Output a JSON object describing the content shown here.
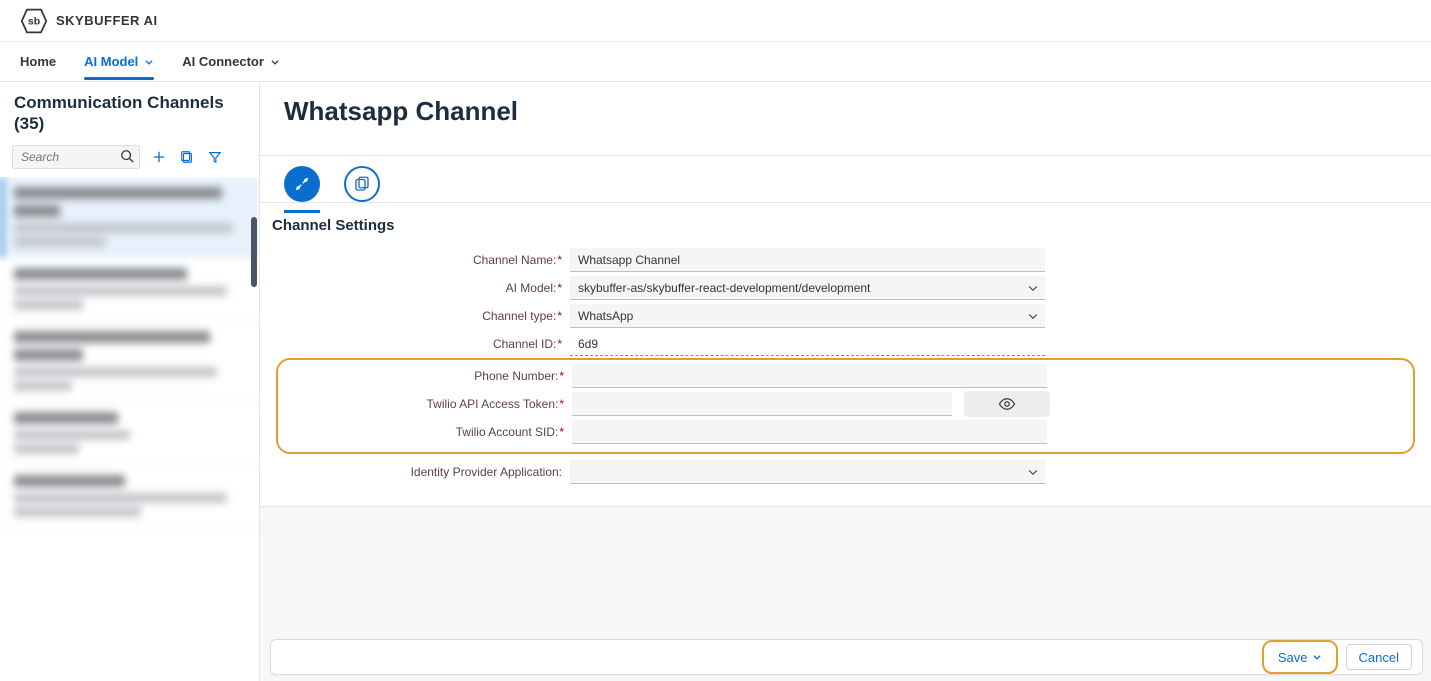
{
  "header": {
    "brand": "SKYBUFFER AI",
    "logo_letters": "sb"
  },
  "nav": {
    "home": "Home",
    "ai_model": "AI Model",
    "ai_connector": "AI Connector"
  },
  "sidebar": {
    "title": "Communication Channels (35)",
    "search_placeholder": "Search"
  },
  "main": {
    "page_title": "Whatsapp Channel",
    "section_title": "Channel Settings",
    "labels": {
      "channel_name": "Channel Name:",
      "ai_model": "AI Model:",
      "channel_type": "Channel type:",
      "channel_id": "Channel ID:",
      "phone_number": "Phone Number:",
      "twilio_token": "Twilio API Access Token:",
      "twilio_sid": "Twilio Account SID:",
      "idp_app": "Identity Provider Application:"
    },
    "values": {
      "channel_name": "Whatsapp Channel",
      "ai_model": "skybuffer-as/skybuffer-react-development/development",
      "channel_type": "WhatsApp",
      "channel_id": "6d9",
      "phone_number": "",
      "twilio_token": "",
      "twilio_sid": "",
      "idp_app": ""
    }
  },
  "footer": {
    "save": "Save",
    "cancel": "Cancel"
  }
}
